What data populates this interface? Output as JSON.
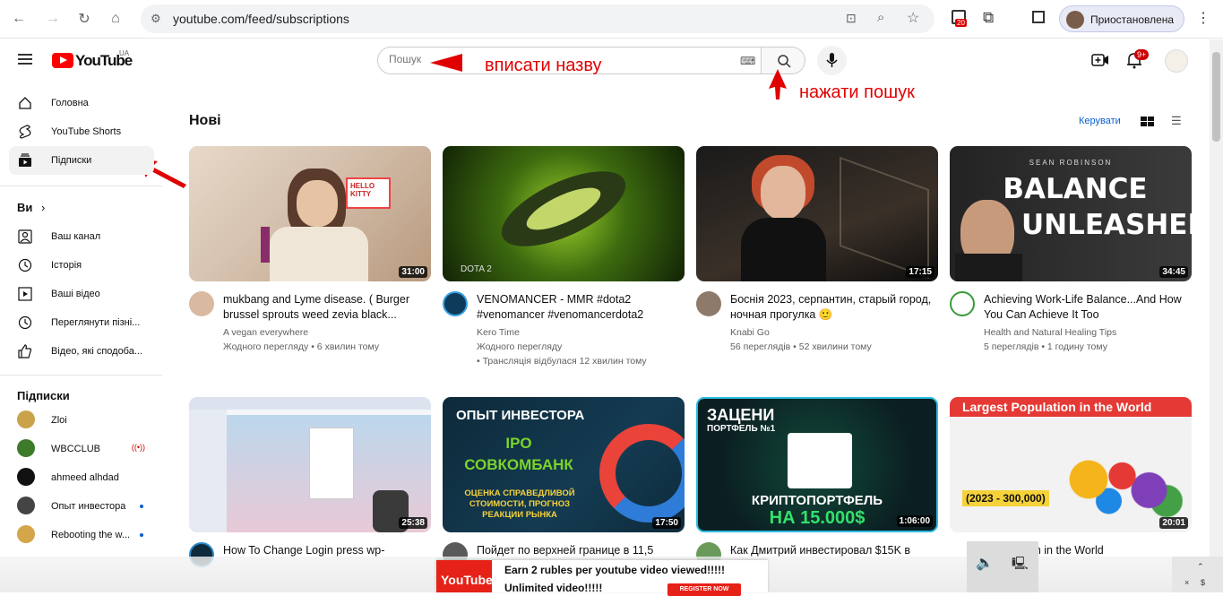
{
  "browser": {
    "url": "youtube.com/feed/subscriptions",
    "profile_label": "Приостановлена",
    "ext_badge": "20"
  },
  "header": {
    "logo_text": "YouTube",
    "region": "UA",
    "search_placeholder": "Пошук",
    "notifications_badge": "9+"
  },
  "annotations": {
    "search_hint": "вписати назву",
    "button_hint": "нажати пошук"
  },
  "sidebar": {
    "top_items": [
      {
        "label": "Головна",
        "icon": "home-icon"
      },
      {
        "label": "YouTube Shorts",
        "icon": "shorts-icon"
      },
      {
        "label": "Підписки",
        "icon": "subscriptions-icon"
      }
    ],
    "you_title": "Ви",
    "you_items": [
      {
        "label": "Ваш канал",
        "icon": "channel-icon"
      },
      {
        "label": "Історія",
        "icon": "history-icon"
      },
      {
        "label": "Ваші відео",
        "icon": "your-videos-icon"
      },
      {
        "label": "Переглянути пізні...",
        "icon": "watch-later-icon"
      },
      {
        "label": "Відео, які сподоба...",
        "icon": "like-icon"
      }
    ],
    "subs_title": "Підписки",
    "subs": [
      {
        "label": "Zloi",
        "color": "#c9a24a"
      },
      {
        "label": "WBCCLUB",
        "color": "#3d7a2a",
        "live": true
      },
      {
        "label": "ahmeed alhdad",
        "color": "#111111"
      },
      {
        "label": "Опыт инвестора",
        "color": "#444444",
        "dot": true
      },
      {
        "label": "Rebooting the w...",
        "color": "#d4a64a",
        "dot": true
      }
    ]
  },
  "main": {
    "section_title": "Нові",
    "manage_label": "Керувати",
    "videos": [
      {
        "title": "mukbang and Lyme disease. ( Burger brussel sprouts weed zevia black...",
        "channel": "A vegan everywhere",
        "meta": "Жодного перегляду • 6 хвилин тому",
        "meta2": "",
        "duration": "31:00"
      },
      {
        "title": "VENOMANCER - MMR #dota2 #venomancer #venomancerdota2",
        "channel": "Kero Time",
        "meta": "Жодного перегляду",
        "meta2": "• Трансляція відбулася 12 хвилин тому",
        "duration": ""
      },
      {
        "title": "Боснія 2023, серпантин, старый город, ночная прогулка 🙂",
        "channel": "Knabi Go",
        "meta": "56 переглядів • 52 хвилини тому",
        "meta2": "",
        "duration": "17:15"
      },
      {
        "title": "Achieving Work-Life Balance...And How You Can Achieve It Too",
        "channel": "Health and Natural Healing Tips",
        "meta": "5 переглядів • 1 годину тому",
        "meta2": "",
        "duration": "34:45"
      },
      {
        "title": "How To Change Login press wp-",
        "channel": "",
        "meta": "",
        "meta2": "",
        "duration": "25:38"
      },
      {
        "title": "Пойдет по верхней границе в 11,5",
        "channel": "",
        "meta": "",
        "meta2": "",
        "duration": "17:50"
      },
      {
        "title": "Как Дмитрий инвестировал $15K в",
        "channel": "",
        "meta": "",
        "meta2": "",
        "duration": "1:06:00"
      },
      {
        "title": "pulation in the World",
        "channel": "",
        "meta": "",
        "meta2": "",
        "duration": "20:01"
      }
    ],
    "thumb_text": {
      "balance1": "SEAN ROBINSON",
      "balance2": "BALANCE",
      "balance3": "UNLEASHED",
      "investor1": "ОПЫТ ИНВЕСТОРА",
      "investor2": "IPO",
      "investor3": "СОВКОМБАНК",
      "investor4": "ОЦЕНКА СПРАВЕДЛИВОЙ СТОИМОСТИ, ПРОГНОЗ РЕАКЦИИ РЫНКА",
      "zaceni1": "ЗАЦЕНИ",
      "zaceni2": "ПОРТФЕЛЬ №1",
      "zaceni3": "КРИПТОПОРТФЕЛЬ",
      "zaceni4": "НА 15.000$",
      "pop1": "Largest Population in the World",
      "pop2": "(2023 - 300,000)"
    }
  },
  "ad": {
    "logo": "YouTube",
    "line1": "Earn 2 rubles per youtube video viewed!!!!!",
    "line2": "Unlimited video!!!!!",
    "cta": "REGISTER NOW"
  }
}
